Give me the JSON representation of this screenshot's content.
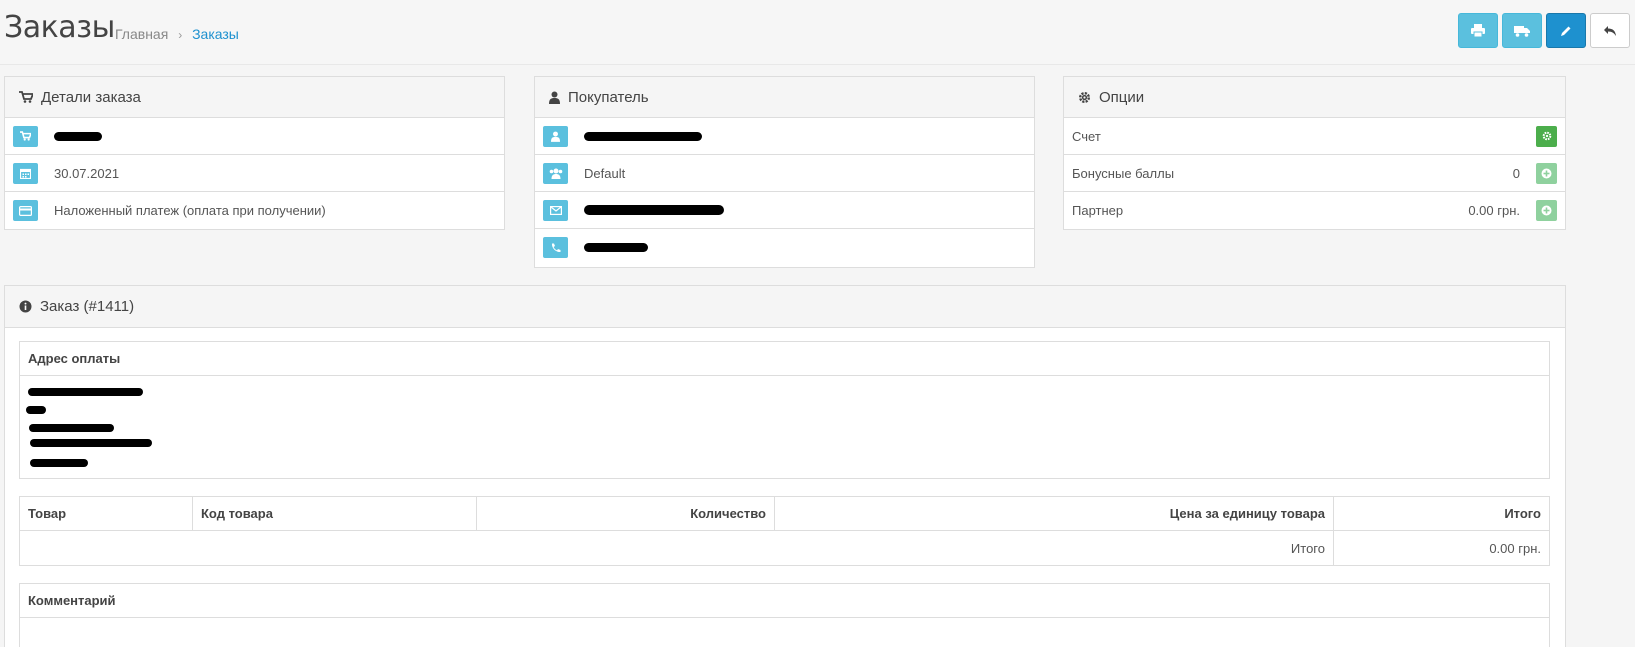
{
  "header": {
    "title": "Заказы",
    "breadcrumb": {
      "home": "Главная",
      "separator": "›",
      "current": "Заказы"
    },
    "toolbar": {
      "print_icon": "print-icon",
      "shipping_icon": "truck-icon",
      "edit_icon": "pencil-icon",
      "back_icon": "reply-icon"
    }
  },
  "order_details": {
    "title": "Детали заказа",
    "date": "30.07.2021",
    "payment_method": "Наложенный платеж (оплата при получении)"
  },
  "customer": {
    "title": "Покупатель",
    "group": "Default"
  },
  "options": {
    "title": "Опции",
    "invoice_label": "Счет",
    "reward_label": "Бонусные баллы",
    "reward_value": "0",
    "affiliate_label": "Партнер",
    "affiliate_value": "0.00 грн."
  },
  "order": {
    "title": "Заказ (#1411)",
    "payment_address_label": "Адрес оплаты",
    "products": {
      "columns": [
        "Товар",
        "Код товара",
        "Количество",
        "Цена за единицу товара",
        "Итого"
      ],
      "total_label": "Итого",
      "total_value": "0.00 грн."
    },
    "comment_label": "Комментарий"
  },
  "colors": {
    "info": "#5bc0de",
    "primary": "#1e91cf",
    "success": "#4cae4c"
  }
}
